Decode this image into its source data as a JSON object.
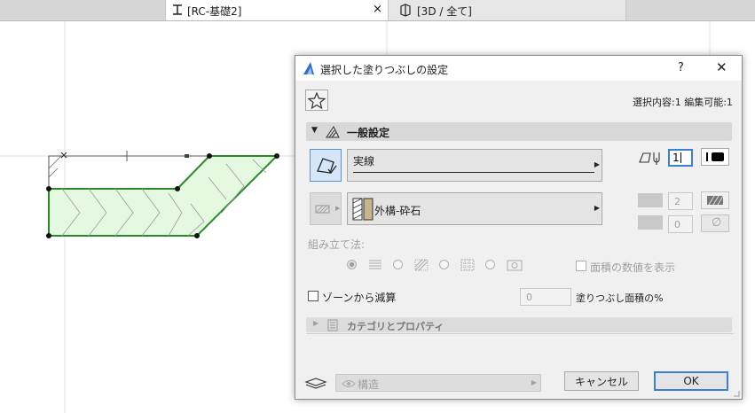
{
  "tabs": [
    {
      "label": "[RC-基礎2]",
      "close": "×",
      "icon": "section-icon",
      "active": true
    },
    {
      "label": "[3D / 全て]",
      "icon": "3d-icon",
      "active": false
    }
  ],
  "dialog": {
    "title": "選択した塗りつぶしの設定",
    "help": "?",
    "close": "✕",
    "selection_info": "選択内容:1 編集可能:1",
    "general_section": "一般設定",
    "line_type": "実線",
    "pen_number": "1",
    "fill_name": "外構-砕石",
    "fill_pen": "2",
    "bg_pen": "0",
    "construction_method": "組み立て法:",
    "show_area": "面積の数値を表示",
    "zone_subtract": "ゾーンから減算",
    "percent_value": "0",
    "percent_label": "塗りつぶし面積の%",
    "category_section": "カテゴリとプロパティ",
    "layer_name": "構造",
    "cancel": "キャンセル",
    "ok": "OK"
  },
  "colors": {
    "fill_green": "#e5f8e0",
    "outline_green": "#2a8a2a",
    "ok_border": "#3c7fd0"
  }
}
